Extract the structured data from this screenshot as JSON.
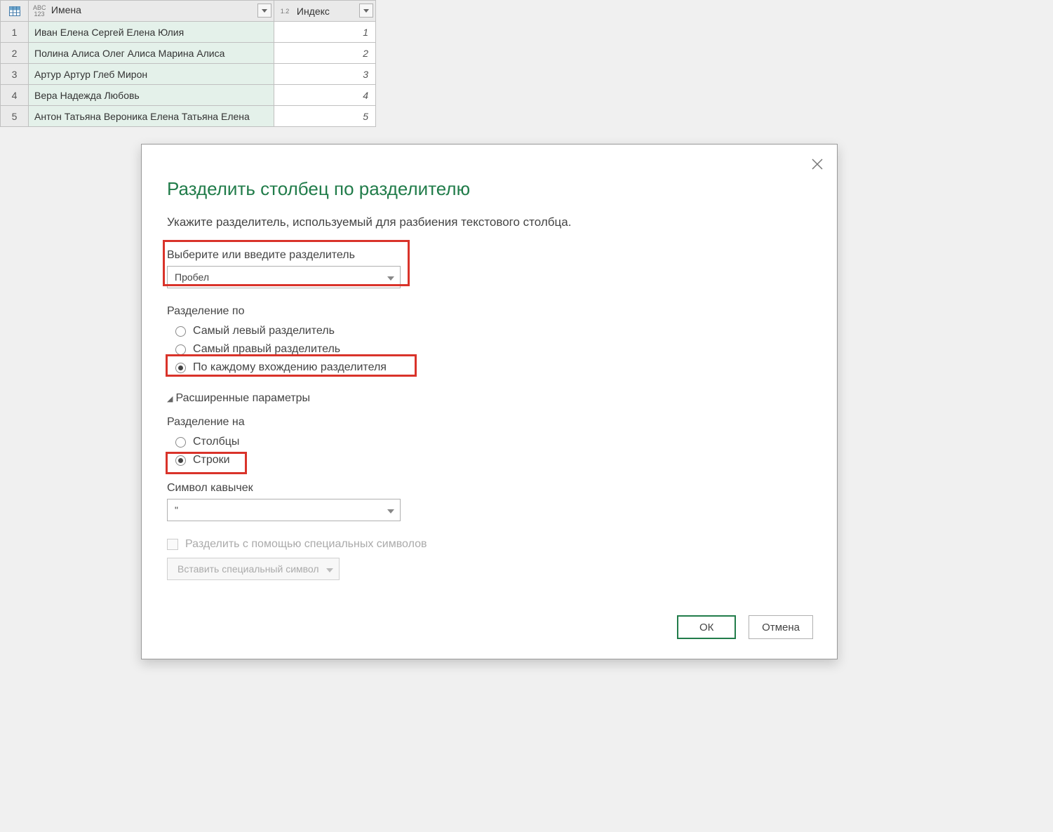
{
  "table": {
    "columns": [
      {
        "type_top": "ABC",
        "type_bot": "123",
        "name": "Имена"
      },
      {
        "type_top": "1.2",
        "type_bot": "",
        "name": "Индекс"
      }
    ],
    "rows": [
      {
        "n": "1",
        "names": "Иван Елена Сергей Елена Юлия",
        "index": "1"
      },
      {
        "n": "2",
        "names": "Полина Алиса Олег Алиса Марина Алиса",
        "index": "2"
      },
      {
        "n": "3",
        "names": "Артур Артур Глеб Мирон",
        "index": "3"
      },
      {
        "n": "4",
        "names": "Вера Надежда Любовь",
        "index": "4"
      },
      {
        "n": "5",
        "names": "Антон Татьяна Вероника Елена Татьяна Елена",
        "index": "5"
      }
    ]
  },
  "dialog": {
    "title": "Разделить столбец по разделителю",
    "subtitle": "Укажите разделитель, используемый для разбиения текстового столбца.",
    "delimiter": {
      "label": "Выберите или введите разделитель",
      "value": "Пробел"
    },
    "splitBy": {
      "label": "Разделение по",
      "options": {
        "left": "Самый левый разделитель",
        "right": "Самый правый разделитель",
        "each": "По каждому вхождению разделителя"
      }
    },
    "advanced": {
      "title": "Расширенные параметры",
      "splitInto": {
        "label": "Разделение на",
        "columns": "Столбцы",
        "rows": "Строки"
      },
      "quote": {
        "label": "Символ кавычек",
        "value": "\""
      },
      "special": {
        "chk": "Разделить с помощью специальных символов",
        "btn": "Вставить специальный символ"
      }
    },
    "buttons": {
      "ok": "ОК",
      "cancel": "Отмена"
    }
  }
}
